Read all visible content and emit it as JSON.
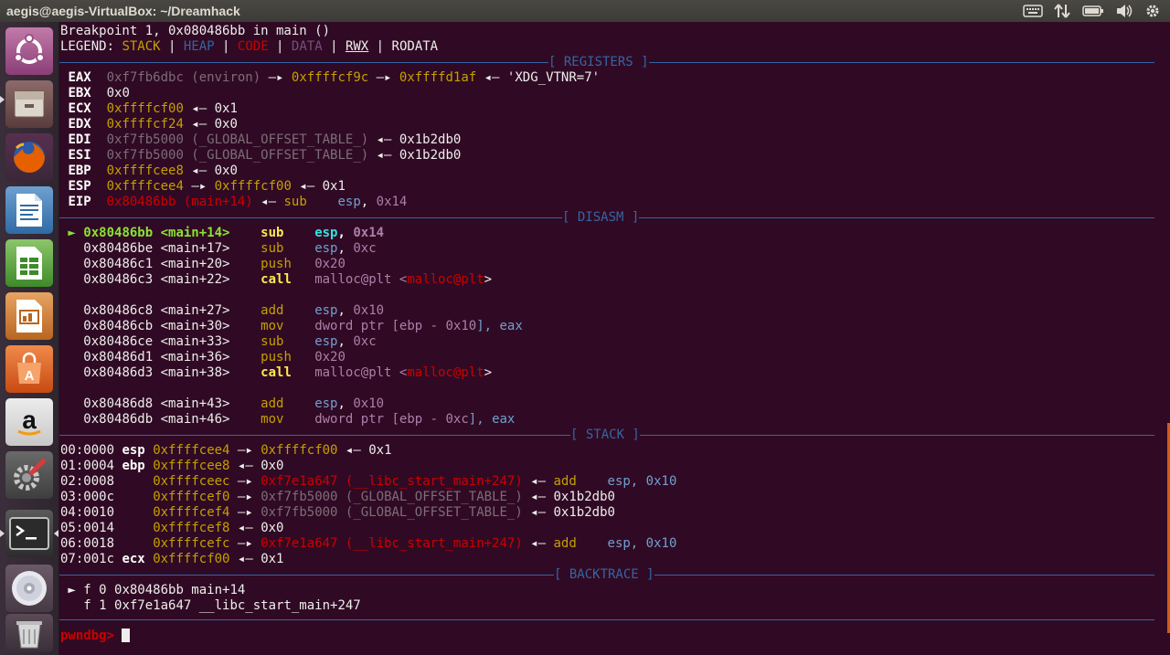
{
  "topbar": {
    "title": "aegis@aegis-VirtualBox: ~/Dreamhack",
    "tray_icons": [
      "keyboard-icon",
      "network-icon",
      "battery-icon",
      "volume-icon",
      "settings-icon"
    ]
  },
  "launcher": {
    "items": [
      "ubuntu-dash-icon",
      "files-icon",
      "firefox-icon",
      "writer-icon",
      "calc-icon",
      "impress-icon",
      "software-center-icon",
      "amazon-icon",
      "system-settings-icon",
      "terminal-icon",
      "dvd-icon",
      "trash-icon"
    ]
  },
  "colors": {
    "terminal_bg": "#300a24",
    "stack": "#c4a000",
    "heap": "#3465a4",
    "code": "#cc0000",
    "data": "#75507b",
    "separator": "#3465a4"
  },
  "terminal": {
    "line0": "Breakpoint 1, 0x080486bb in main ()",
    "legend": {
      "prefix": "LEGEND: ",
      "stack": "STACK",
      "bar": " | ",
      "heap": "HEAP",
      "code": "CODE",
      "data": "DATA",
      "rwx": "RWX",
      "rodata": "RODATA"
    },
    "sections": {
      "registers": "[ REGISTERS ]",
      "disasm": "[ DISASM ]",
      "stack": "[ STACK ]",
      "backtrace": "[ BACKTRACE ]"
    },
    "registers": {
      "eax": {
        "name": "EAX",
        "a": "0xf7fb6dbc (environ)",
        "arrow1": " —▸ ",
        "b": "0xffffcf9c",
        "arrow2": " —▸ ",
        "c": "0xffffd1af",
        "arrow3": " ◂— ",
        "d": "'XDG_VTNR=7'"
      },
      "ebx": {
        "name": "EBX",
        "a": "0x0"
      },
      "ecx": {
        "name": "ECX",
        "a": "0xffffcf00",
        "arrow": " ◂— ",
        "b": "0x1"
      },
      "edx": {
        "name": "EDX",
        "a": "0xffffcf24",
        "arrow": " ◂— ",
        "b": "0x0"
      },
      "edi": {
        "name": "EDI",
        "a": "0xf7fb5000 (_GLOBAL_OFFSET_TABLE_)",
        "arrow": " ◂— ",
        "b": "0x1b2db0"
      },
      "esi": {
        "name": "ESI",
        "a": "0xf7fb5000 (_GLOBAL_OFFSET_TABLE_)",
        "arrow": " ◂— ",
        "b": "0x1b2db0"
      },
      "ebp": {
        "name": "EBP",
        "a": "0xffffcee8",
        "arrow": " ◂— ",
        "b": "0x0"
      },
      "esp": {
        "name": "ESP",
        "a": "0xffffcee4",
        "arrow1": " —▸ ",
        "b": "0xffffcf00",
        "arrow2": " ◂— ",
        "c": "0x1"
      },
      "eip": {
        "name": "EIP",
        "a": "0x80486bb (main+14)",
        "arrow": " ◂— ",
        "op": "sub",
        "sp": "    ",
        "r1": "esp",
        "comma": ", ",
        "n": "0x14"
      }
    },
    "disasm": [
      {
        "marker": " ► ",
        "addr": "0x80486bb <main+14>",
        "op": "sub",
        "arg1": "esp",
        "sep": ", ",
        "arg2": "0x14"
      },
      {
        "marker": "   ",
        "addr": "0x80486be <main+17>",
        "op": "sub",
        "arg1": "esp",
        "sep": ", ",
        "arg2": "0xc"
      },
      {
        "marker": "   ",
        "addr": "0x80486c1 <main+20>",
        "op": "push",
        "arg1": "0x20",
        "sep": "",
        "arg2": ""
      },
      {
        "marker": "   ",
        "addr": "0x80486c3 <main+22>",
        "op": "call",
        "arg1": "malloc@plt <",
        "sep": "malloc@plt",
        "arg2": ">"
      },
      {
        "marker": "   ",
        "addr": "0x80486c8 <main+27>",
        "op": "add",
        "arg1": "esp",
        "sep": ", ",
        "arg2": "0x10"
      },
      {
        "marker": "   ",
        "addr": "0x80486cb <main+30>",
        "op": "mov",
        "arg1": "dword ptr [ebp - ",
        "sep": "0x10",
        "arg2": "], eax"
      },
      {
        "marker": "   ",
        "addr": "0x80486ce <main+33>",
        "op": "sub",
        "arg1": "esp",
        "sep": ", ",
        "arg2": "0xc"
      },
      {
        "marker": "   ",
        "addr": "0x80486d1 <main+36>",
        "op": "push",
        "arg1": "0x20",
        "sep": "",
        "arg2": ""
      },
      {
        "marker": "   ",
        "addr": "0x80486d3 <main+38>",
        "op": "call",
        "arg1": "malloc@plt <",
        "sep": "malloc@plt",
        "arg2": ">"
      },
      {
        "marker": "   ",
        "addr": "0x80486d8 <main+43>",
        "op": "add",
        "arg1": "esp",
        "sep": ", ",
        "arg2": "0x10"
      },
      {
        "marker": "   ",
        "addr": "0x80486db <main+46>",
        "op": "mov",
        "arg1": "dword ptr [ebp - ",
        "sep": "0xc",
        "arg2": "], eax"
      }
    ],
    "stack": [
      {
        "idx": "00:0000",
        "reg": "esp",
        "addr": "0xffffcee4",
        "a1": " —▸ ",
        "v": "0xffffcf00",
        "a2": " ◂— ",
        "w": "0x1",
        "op": "",
        "tail": ""
      },
      {
        "idx": "01:0004",
        "reg": "ebp",
        "addr": "0xffffcee8",
        "a1": " ◂— ",
        "v": "0x0",
        "a2": "",
        "w": "",
        "op": "",
        "tail": ""
      },
      {
        "idx": "02:0008",
        "reg": "   ",
        "addr": "0xffffceec",
        "a1": " —▸ ",
        "v": "0xf7e1a647 (__libc_start_main+247)",
        "a2": " ◂— ",
        "w": "",
        "op": "add",
        "tail": "    esp, 0x10"
      },
      {
        "idx": "03:000c",
        "reg": "   ",
        "addr": "0xffffcef0",
        "a1": " —▸ ",
        "v": "0xf7fb5000 (_GLOBAL_OFFSET_TABLE_)",
        "a2": " ◂— ",
        "w": "0x1b2db0",
        "op": "",
        "tail": ""
      },
      {
        "idx": "04:0010",
        "reg": "   ",
        "addr": "0xffffcef4",
        "a1": " —▸ ",
        "v": "0xf7fb5000 (_GLOBAL_OFFSET_TABLE_)",
        "a2": " ◂— ",
        "w": "0x1b2db0",
        "op": "",
        "tail": ""
      },
      {
        "idx": "05:0014",
        "reg": "   ",
        "addr": "0xffffcef8",
        "a1": " ◂— ",
        "v": "0x0",
        "a2": "",
        "w": "",
        "op": "",
        "tail": ""
      },
      {
        "idx": "06:0018",
        "reg": "   ",
        "addr": "0xffffcefc",
        "a1": " —▸ ",
        "v": "0xf7e1a647 (__libc_start_main+247)",
        "a2": " ◂— ",
        "w": "",
        "op": "add",
        "tail": "    esp, 0x10"
      },
      {
        "idx": "07:001c",
        "reg": "ecx",
        "addr": "0xffffcf00",
        "a1": " ◂— ",
        "v": "0x1",
        "a2": "",
        "w": "",
        "op": "",
        "tail": ""
      }
    ],
    "backtrace": [
      {
        "marker": " ► ",
        "text": "f 0 0x80486bb main+14"
      },
      {
        "marker": "   ",
        "text": "f 1 0xf7e1a647 __libc_start_main+247"
      }
    ],
    "prompt": "pwndbg> "
  }
}
